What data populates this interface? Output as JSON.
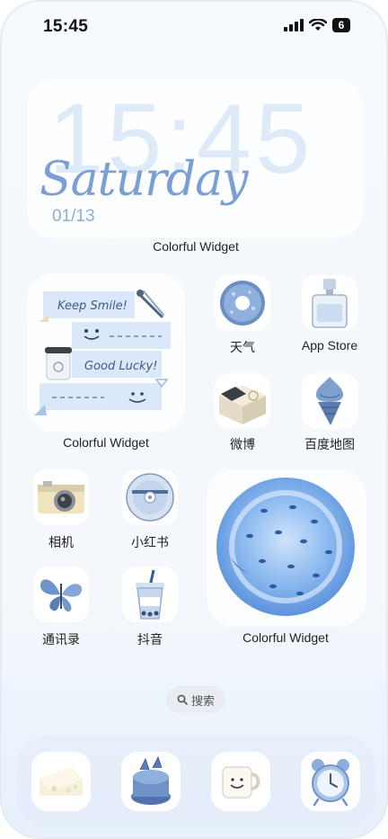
{
  "status_bar": {
    "time": "15:45",
    "battery": "6"
  },
  "clock_widget": {
    "time": "15:45",
    "day": "Saturday",
    "date": "01/13",
    "label": "Colorful Widget"
  },
  "smile_widget": {
    "line1": "Keep Smile!",
    "line2": "Good Lucky!",
    "label": "Colorful Widget"
  },
  "apps": [
    {
      "label": "天气",
      "icon": "donut-icon"
    },
    {
      "label": "App Store",
      "icon": "perfume-icon"
    },
    {
      "label": "微博",
      "icon": "box-icon"
    },
    {
      "label": "百度地图",
      "icon": "ice-cream-icon"
    },
    {
      "label": "相机",
      "icon": "camera-icon"
    },
    {
      "label": "小红书",
      "icon": "cd-icon"
    },
    {
      "label": "通讯录",
      "icon": "butterfly-icon"
    },
    {
      "label": "抖音",
      "icon": "drink-icon"
    }
  ],
  "bubble_widget": {
    "label": "Colorful Widget"
  },
  "search": {
    "label": "搜索",
    "icon": "search-icon"
  },
  "dock": [
    {
      "icon": "cheese-icon"
    },
    {
      "icon": "cake-icon"
    },
    {
      "icon": "mug-icon"
    },
    {
      "icon": "alarm-clock-icon"
    }
  ],
  "colors": {
    "accent": "#7a9ed6",
    "accent_light": "#dfeaf8",
    "label": "#222222"
  }
}
